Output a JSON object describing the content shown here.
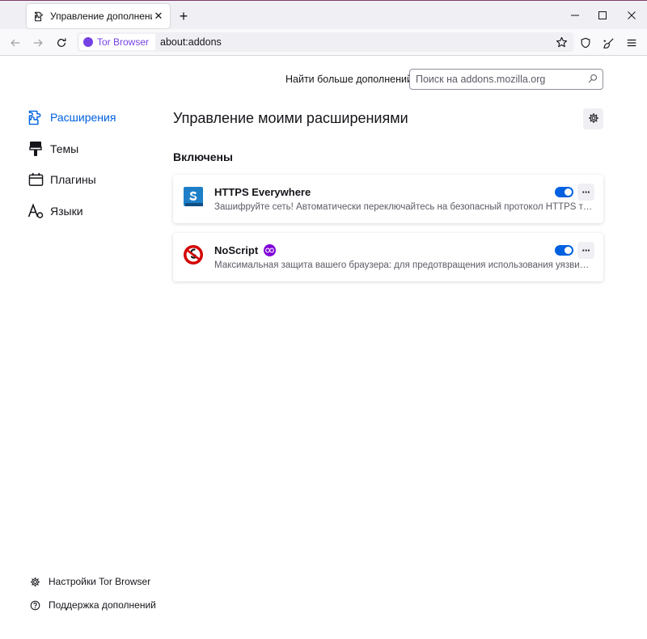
{
  "tab": {
    "title": "Управление дополнениями",
    "close": "✕"
  },
  "new_tab": "+",
  "navbar": {
    "identity_label": "Tor Browser",
    "url": "about:addons"
  },
  "search": {
    "label": "Найти больше дополнений",
    "placeholder": "Поиск на addons.mozilla.org"
  },
  "sidebar": {
    "items": [
      {
        "label": "Расширения",
        "icon": "puzzle-icon",
        "active": true
      },
      {
        "label": "Темы",
        "icon": "brush-icon"
      },
      {
        "label": "Плагины",
        "icon": "plugin-icon"
      },
      {
        "label": "Языки",
        "icon": "language-icon"
      }
    ],
    "footer": [
      {
        "label": "Настройки Tor Browser",
        "icon": "gear-icon"
      },
      {
        "label": "Поддержка дополнений",
        "icon": "help-icon"
      }
    ]
  },
  "main": {
    "heading": "Управление моими расширениями",
    "section_heading": "Включены",
    "addons": [
      {
        "name": "HTTPS Everywhere",
        "description": "Зашифруйте сеть! Автоматически переключайтесь на безопасный протокол HTTPS там, где это возможно.",
        "enabled": true,
        "more": "···"
      },
      {
        "name": "NoScript",
        "description": "Максимальная защита вашего браузера: для предотвращения использования уязвимостей и XSS-атак.",
        "enabled": true,
        "more": "···",
        "badge": "recommended-badge-icon"
      }
    ]
  },
  "colors": {
    "accent": "#0061e0",
    "tor_purple": "#7542e5",
    "badge_purple": "#8000d7"
  }
}
